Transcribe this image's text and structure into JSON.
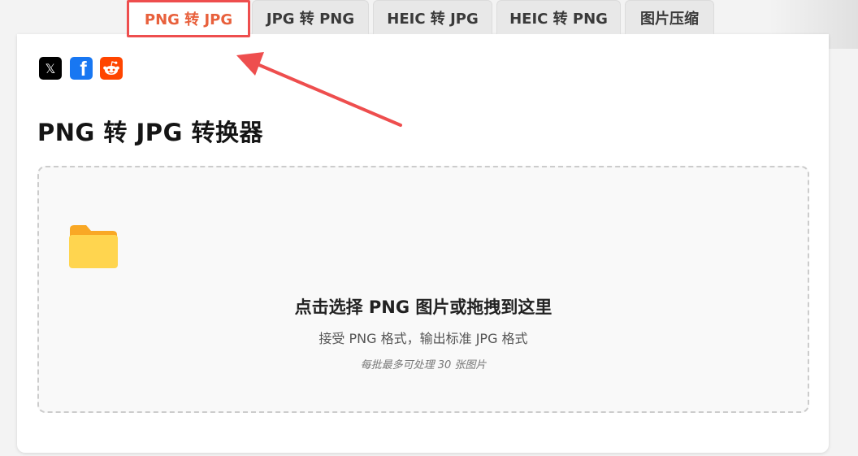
{
  "tabs": [
    {
      "label": "PNG 转 JPG",
      "active": true
    },
    {
      "label": "JPG 转 PNG",
      "active": false
    },
    {
      "label": "HEIC 转 JPG",
      "active": false
    },
    {
      "label": "HEIC 转 PNG",
      "active": false
    },
    {
      "label": "图片压缩",
      "active": false
    }
  ],
  "share": {
    "icons": [
      "x-icon",
      "facebook-icon",
      "reddit-icon"
    ],
    "x_glyph": "𝕏",
    "facebook_glyph": "f"
  },
  "converter": {
    "title": "PNG 转 JPG 转换器",
    "dropzone": {
      "icon": "folder-icon",
      "main_text": "点击选择 PNG 图片或拖拽到这里",
      "sub_text": "接受 PNG 格式，输出标准 JPG 格式",
      "note_text": "每批最多可处理 30 张图片"
    }
  },
  "colors": {
    "accent": "#e8603c",
    "highlight_border": "#ee4e4e",
    "facebook": "#1877f2",
    "reddit": "#ff4500",
    "folder": "#ffd54f"
  }
}
